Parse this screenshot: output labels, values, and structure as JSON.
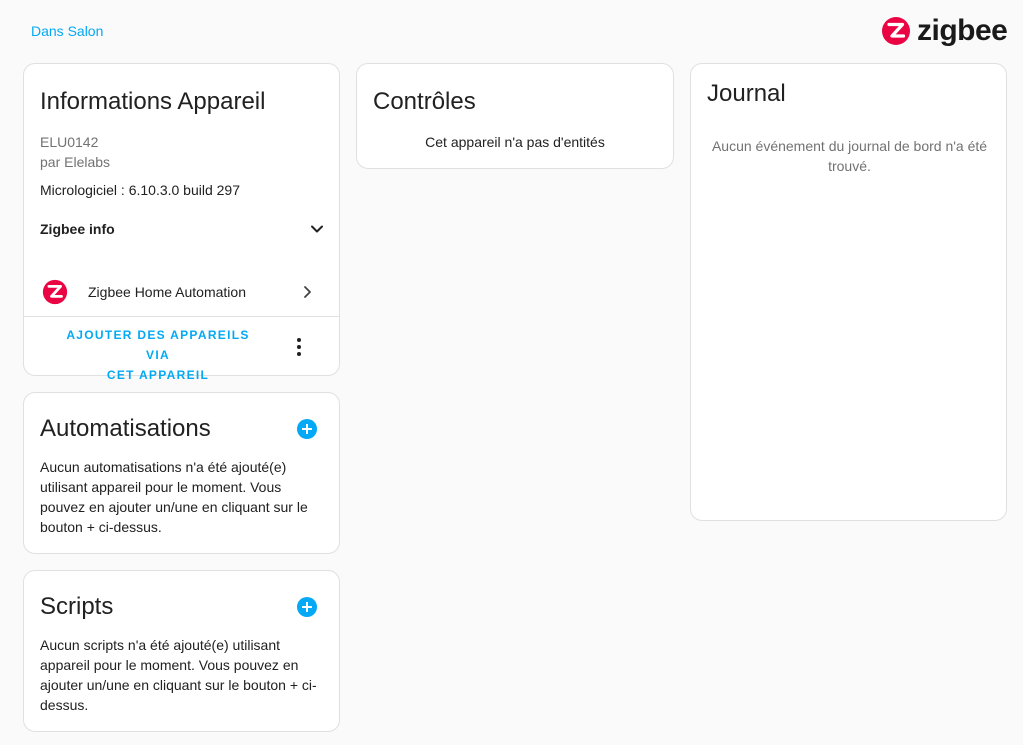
{
  "header": {
    "area_link": "Dans Salon",
    "brand_text": "zigbee"
  },
  "device_info": {
    "title": "Informations Appareil",
    "model": "ELU0142",
    "manufacturer": "par Elelabs",
    "firmware": "Micrologiciel : 6.10.3.0 build 297",
    "zigbee_info_label": "Zigbee info",
    "integration_label": "Zigbee Home Automation",
    "action_label_line1": "AJOUTER DES APPAREILS VIA",
    "action_label_line2": "CET APPAREIL"
  },
  "controls": {
    "title": "Contrôles",
    "empty_text": "Cet appareil n'a pas d'entités"
  },
  "logbook": {
    "title": "Journal",
    "empty_text": "Aucun événement du journal de bord n'a été trouvé."
  },
  "automations": {
    "title": "Automatisations",
    "empty_text": "Aucun automatisations n'a été ajouté(e) utilisant appareil pour le moment. Vous pouvez en ajouter un/une en cliquant sur le bouton + ci-dessus."
  },
  "scripts": {
    "title": "Scripts",
    "empty_text": "Aucun scripts n'a été ajouté(e) utilisant appareil pour le moment. Vous pouvez en ajouter un/une en cliquant sur le bouton + ci-dessus."
  },
  "colors": {
    "accent": "#03a9f4",
    "zigbee_red": "#eb0443",
    "background": "#fafafa",
    "card": "#ffffff",
    "secondary_text": "#727272"
  },
  "icons": {
    "brand": "zigbee-logo-icon",
    "zigbee_info_toggle": "chevron-down-icon",
    "integration_logo": "zigbee-logo-icon",
    "integration_nav": "chevron-right-icon",
    "overflow": "dots-vertical-icon",
    "add": "plus-circle-icon"
  }
}
